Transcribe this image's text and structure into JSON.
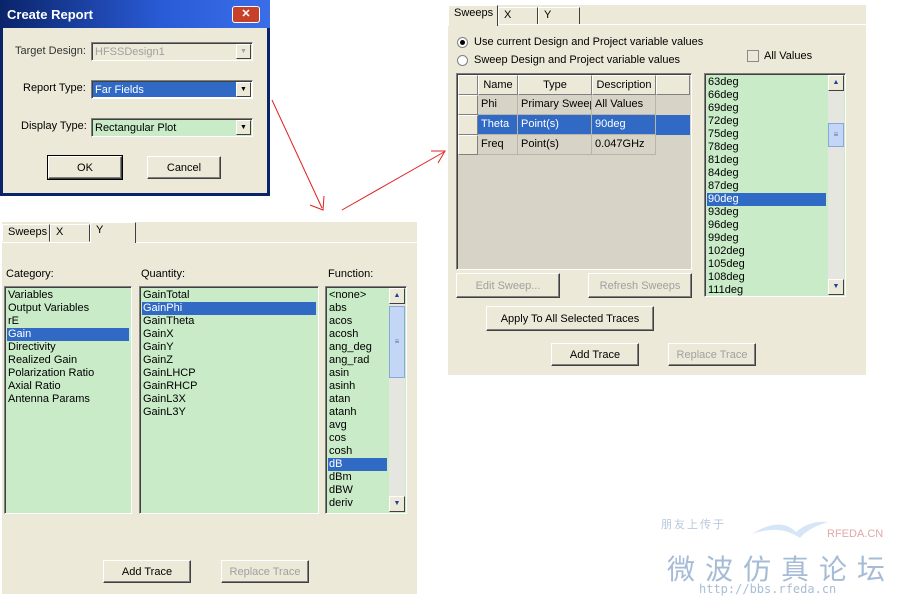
{
  "create_report": {
    "title": "Create Report",
    "target_design_label": "Target Design:",
    "target_design_value": "HFSSDesign1",
    "report_type_label": "Report Type:",
    "report_type_value": "Far Fields",
    "display_type_label": "Display Type:",
    "display_type_value": "Rectangular Plot",
    "ok_label": "OK",
    "cancel_label": "Cancel",
    "close_glyph": "✕"
  },
  "y_panel": {
    "tabs": [
      "Sweeps",
      "X",
      "Y"
    ],
    "active_tab": "Y",
    "category_label": "Category:",
    "quantity_label": "Quantity:",
    "function_label": "Function:",
    "categories": [
      "Variables",
      "Output Variables",
      "rE",
      "Gain",
      "Directivity",
      "Realized Gain",
      "Polarization Ratio",
      "Axial Ratio",
      "Antenna Params"
    ],
    "selected_category": "Gain",
    "quantities": [
      "GainTotal",
      "GainPhi",
      "GainTheta",
      "GainX",
      "GainY",
      "GainZ",
      "GainLHCP",
      "GainRHCP",
      "GainL3X",
      "GainL3Y"
    ],
    "selected_quantity": "GainPhi",
    "functions": [
      "<none>",
      "abs",
      "acos",
      "acosh",
      "ang_deg",
      "ang_rad",
      "asin",
      "asinh",
      "atan",
      "atanh",
      "avg",
      "cos",
      "cosh",
      "dB",
      "dBm",
      "dBW",
      "deriv"
    ],
    "selected_function": "dB",
    "add_trace_label": "Add Trace",
    "replace_trace_label": "Replace Trace"
  },
  "sweeps_panel": {
    "tabs": [
      "Sweeps",
      "X",
      "Y"
    ],
    "active_tab": "Sweeps",
    "radio_current": "Use current Design and Project variable values",
    "radio_sweep": "Sweep Design and Project variable values",
    "radio_selected": "current",
    "all_values_label": "All Values",
    "all_values_checked": false,
    "columns": [
      "Name",
      "Type",
      "Description"
    ],
    "rows": [
      {
        "name": "Phi",
        "type": "Primary Sweep",
        "description": "All Values"
      },
      {
        "name": "Theta",
        "type": "Point(s)",
        "description": "90deg"
      },
      {
        "name": "Freq",
        "type": "Point(s)",
        "description": "0.047GHz"
      }
    ],
    "selected_row": "Theta",
    "values": [
      "63deg",
      "66deg",
      "69deg",
      "72deg",
      "75deg",
      "78deg",
      "81deg",
      "84deg",
      "87deg",
      "90deg",
      "93deg",
      "96deg",
      "99deg",
      "102deg",
      "105deg",
      "108deg",
      "111deg"
    ],
    "selected_value": "90deg",
    "edit_sweep_label": "Edit Sweep...",
    "refresh_sweeps_label": "Refresh Sweeps",
    "apply_all_label": "Apply To All Selected Traces",
    "add_trace_label": "Add Trace",
    "replace_trace_label": "Replace Trace"
  },
  "watermark": {
    "line1": "朋友上传于",
    "site": "RFEDA.CN",
    "line2": "微波仿真论坛",
    "url": "http://bbs.rfeda.cn"
  },
  "colors": {
    "list_bg": "#c9ebc7",
    "selection": "#316ac5",
    "titlebar": "#0a246a",
    "arrow": "#e02020"
  }
}
